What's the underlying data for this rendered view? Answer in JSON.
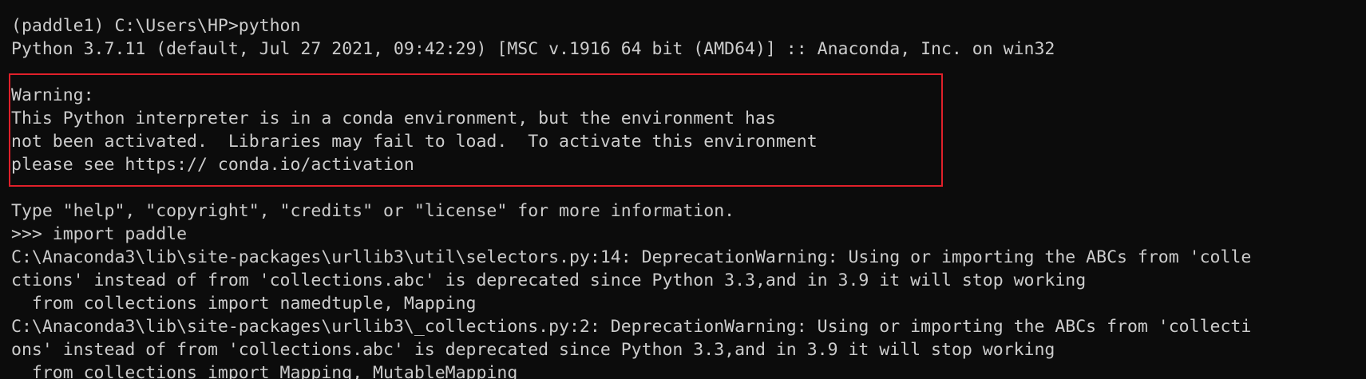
{
  "terminal": {
    "lines": [
      "(paddle1) C:\\Users\\HP>python",
      "Python 3.7.11 (default, Jul 27 2021, 09:42:29) [MSC v.1916 64 bit (AMD64)] :: Anaconda, Inc. on win32",
      "",
      "Warning:",
      "This Python interpreter is in a conda environment, but the environment has",
      "not been activated.  Libraries may fail to load.  To activate this environment",
      "please see https:// conda.io/activation",
      "",
      "Type \"help\", \"copyright\", \"credits\" or \"license\" for more information.",
      ">>> import paddle",
      "C:\\Anaconda3\\lib\\site-packages\\urllib3\\util\\selectors.py:14: DeprecationWarning: Using or importing the ABCs from 'colle",
      "ctions' instead of from 'collections.abc' is deprecated since Python 3.3,and in 3.9 it will stop working",
      "  from collections import namedtuple, Mapping",
      "C:\\Anaconda3\\lib\\site-packages\\urllib3\\_collections.py:2: DeprecationWarning: Using or importing the ABCs from 'collecti",
      "ons' instead of from 'collections.abc' is deprecated since Python 3.3,and in 3.9 it will stop working",
      "  from collections import Mapping, MutableMapping"
    ]
  },
  "colors": {
    "background": "#0c0c0c",
    "foreground": "#cccccc",
    "highlight_border": "#e0202a"
  }
}
